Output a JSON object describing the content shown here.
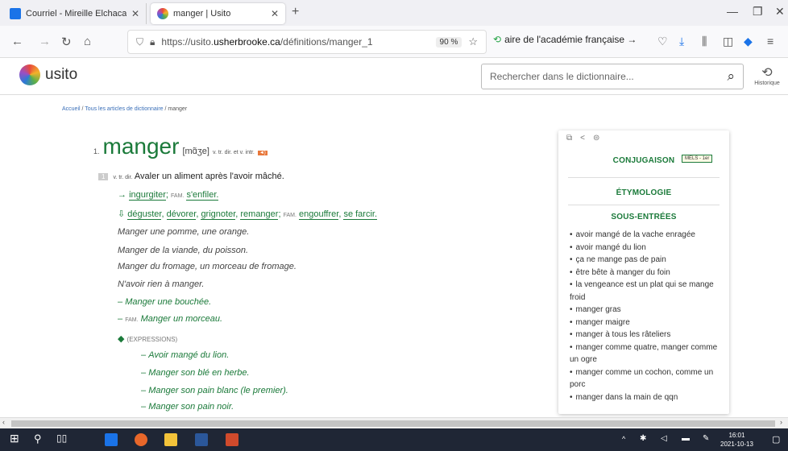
{
  "browser": {
    "tabs": [
      {
        "title": "Courriel - Mireille Elchacar - Ou",
        "favicon_color": "#1a73e8"
      },
      {
        "title": "manger | Usito",
        "favicon_color": "#e8a02c"
      }
    ],
    "url_host": "https://usito.",
    "url_domain": "usherbrooke.ca",
    "url_path": "/définitions/manger_1",
    "zoom": "90 %",
    "bookmark": "aire de l'académie française →"
  },
  "site": {
    "logo": "usito",
    "search_placeholder": "Rechercher dans le dictionnaire...",
    "history_label": "Historique"
  },
  "breadcrumb": {
    "home": "Accueil",
    "sep1": " / ",
    "articles": "Tous les articles de dictionnaire",
    "sep2": " / ",
    "current": "manger"
  },
  "entry": {
    "num": "1.",
    "word": "manger",
    "pron": "[mɑ̃ʒe]",
    "cat": "v. tr. dir. et v. intr.",
    "sense_num": "1",
    "sense_cat": "v. tr. dir.",
    "definition": "Avaler un aliment après l'avoir mâché.",
    "syn_arrow": "→",
    "syn1": "ingurgiter",
    "syn_fam": "FAM.",
    "syn2": "s'enfiler.",
    "rel_icon": "⇩",
    "rel1": "déguster",
    "rel2": "dévorer",
    "rel3": "grignoter",
    "rel4": "remanger",
    "rel_fam": "FAM.",
    "rel5": "engouffrer",
    "rel6": "se farcir.",
    "examples": [
      "Manger une pomme, une orange.",
      "Manger de la viande, du poisson.",
      "Manger du fromage, un morceau de fromage.",
      "N'avoir rien à manger."
    ],
    "green_ex1": "Manger une bouchée.",
    "green_ex2_fam": "FAM.",
    "green_ex2": "Manger un morceau.",
    "expr_label": "(EXPRESSIONS)",
    "expressions": [
      "Avoir mangé du lion.",
      "Manger son blé en herbe.",
      "Manger son pain blanc (le premier).",
      "Manger son pain noir."
    ]
  },
  "sidebar": {
    "conjugaison": "CONJUGAISON",
    "badge": "MELS - 1er",
    "etymologie": "ÉTYMOLOGIE",
    "sous_entrees": "SOUS-ENTRÉES",
    "items": [
      "avoir mangé de la vache enragée",
      "avoir mangé du lion",
      "ça ne mange pas de pain",
      "être bête à manger du foin",
      "la vengeance est un plat qui se mange froid",
      "manger gras",
      "manger maigre",
      "manger à tous les râteliers",
      "manger comme quatre, manger comme un ogre",
      "manger comme un cochon, comme un porc",
      "manger dans la main de qqn"
    ]
  },
  "taskbar": {
    "time": "16:01",
    "date": "2021-10-13"
  }
}
